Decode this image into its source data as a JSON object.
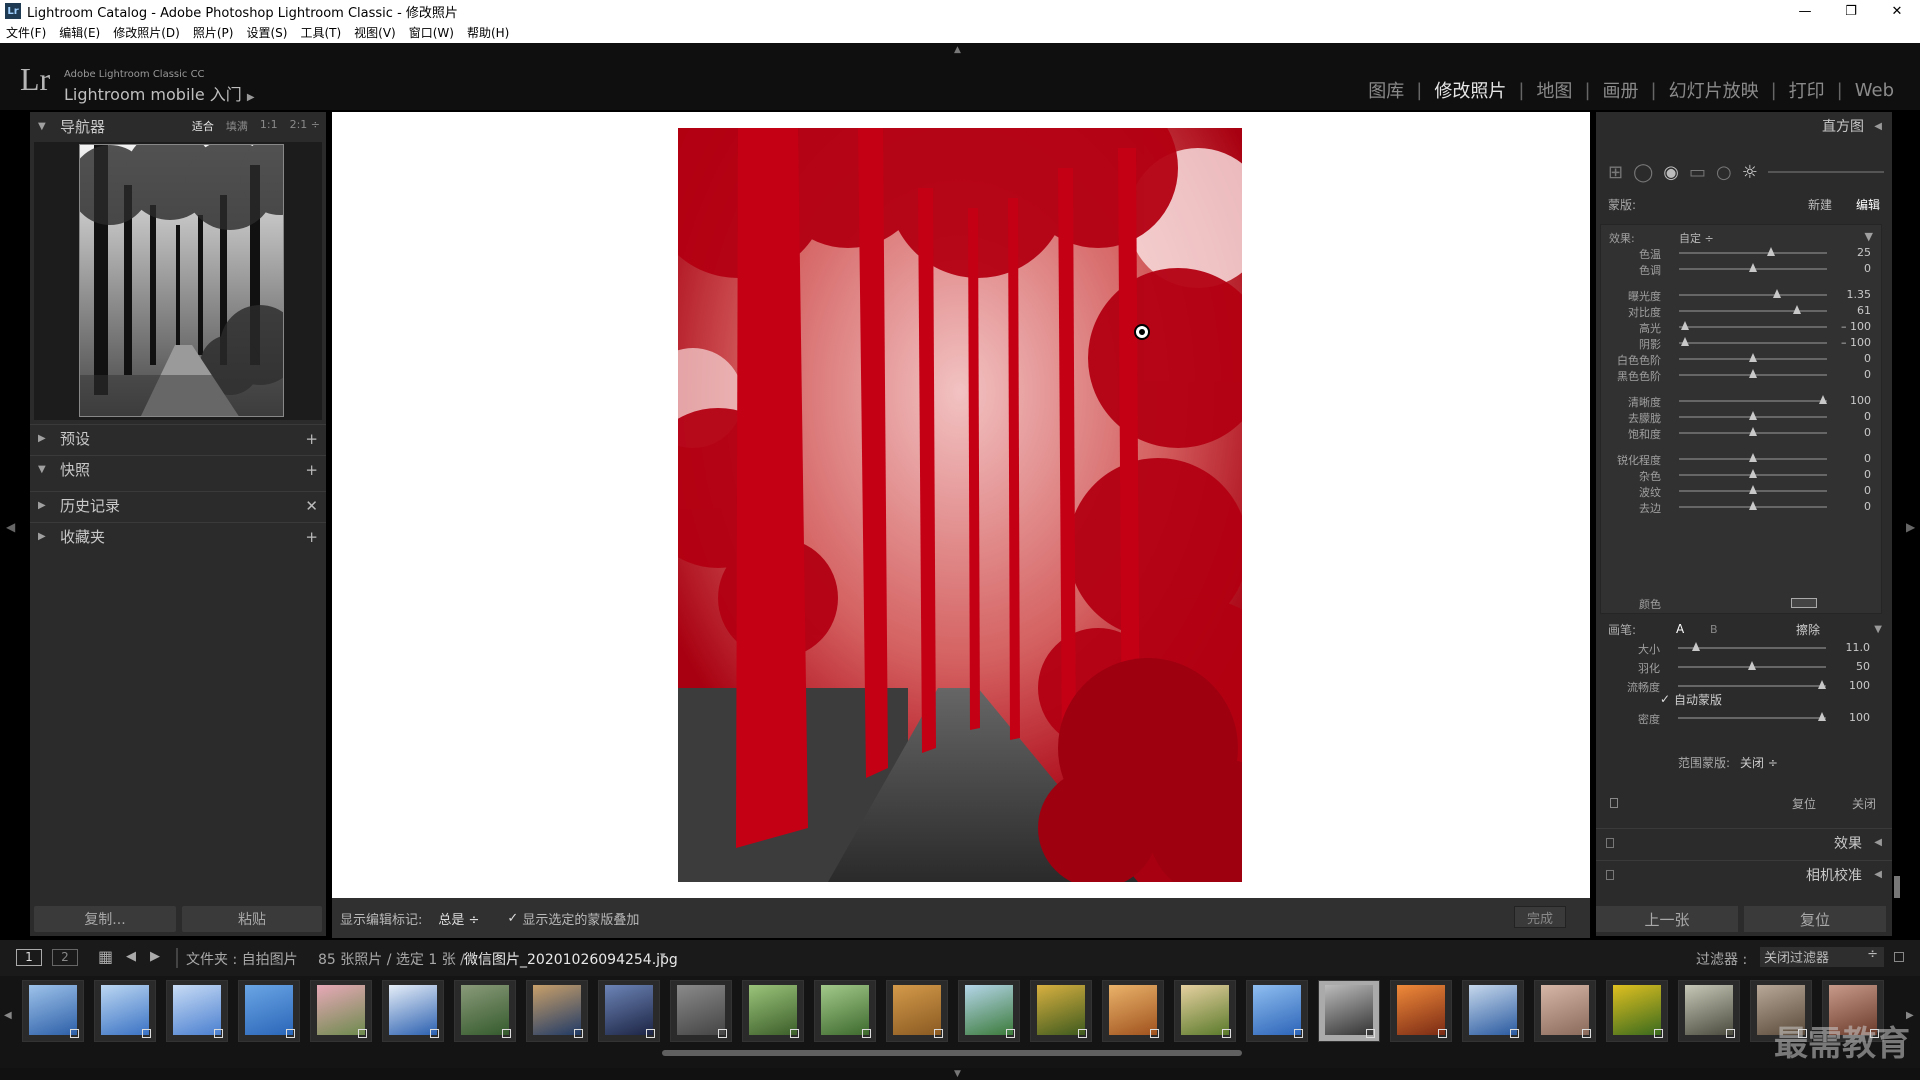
{
  "window": {
    "app_badge": "Lr",
    "title": "Lightroom Catalog - Adobe Photoshop Lightroom Classic - 修改照片",
    "controls": [
      "—",
      "❐",
      "✕"
    ]
  },
  "menu": [
    "文件(F)",
    "编辑(E)",
    "修改照片(D)",
    "照片(P)",
    "设置(S)",
    "工具(T)",
    "视图(V)",
    "窗口(W)",
    "帮助(H)"
  ],
  "identity": {
    "logo": "Lr",
    "small": "Adobe Lightroom Classic CC",
    "big": "Lightroom mobile 入门",
    "arrow": "▶"
  },
  "modules": [
    {
      "label": "图库",
      "active": false
    },
    {
      "label": "修改照片",
      "active": true
    },
    {
      "label": "地图",
      "active": false
    },
    {
      "label": "画册",
      "active": false
    },
    {
      "label": "幻灯片放映",
      "active": false
    },
    {
      "label": "打印",
      "active": false
    },
    {
      "label": "Web",
      "active": false
    }
  ],
  "left_panel": {
    "navigator": {
      "title": "导航器",
      "zoom": [
        "适合",
        "填满",
        "1:1",
        "2:1 ÷"
      ],
      "zoom_active": 0
    },
    "sections": [
      {
        "title": "预设",
        "tri": "▶",
        "action": "+"
      },
      {
        "title": "快照",
        "tri": "▼",
        "action": "+"
      },
      {
        "title": "历史记录",
        "tri": "▶",
        "action": "✕"
      },
      {
        "title": "收藏夹",
        "tri": "▶",
        "action": "+"
      }
    ],
    "copy_button": "复制...",
    "paste_button": "粘贴"
  },
  "toolbar": {
    "show_marks_label": "显示编辑标记:",
    "show_marks_value": "总是 ÷",
    "overlay_check": "✓",
    "overlay_label": "显示选定的蒙版叠加",
    "done_button": "完成"
  },
  "right_panel": {
    "histogram": "直方图",
    "histogram_tri": "◀",
    "mask_label": "蒙版:",
    "mask_new": "新建",
    "mask_edit": "编辑",
    "effect_label": "效果:",
    "effect_value": "自定 ÷",
    "effect_tri": "▼",
    "sliders": [
      {
        "label": "色温",
        "value": "25",
        "pos": 0.62
      },
      {
        "label": "色调",
        "value": "0",
        "pos": 0.5
      },
      {
        "label": "曝光度",
        "value": "1.35",
        "pos": 0.66
      },
      {
        "label": "对比度",
        "value": "61",
        "pos": 0.8
      },
      {
        "label": "高光",
        "value": "– 100",
        "pos": 0.04
      },
      {
        "label": "阴影",
        "value": "– 100",
        "pos": 0.04
      },
      {
        "label": "白色色阶",
        "value": "0",
        "pos": 0.5
      },
      {
        "label": "黑色色阶",
        "value": "0",
        "pos": 0.5
      },
      {
        "label": "清晰度",
        "value": "100",
        "pos": 0.97
      },
      {
        "label": "去朦胧",
        "value": "0",
        "pos": 0.5
      },
      {
        "label": "饱和度",
        "value": "0",
        "pos": 0.5
      },
      {
        "label": "锐化程度",
        "value": "0",
        "pos": 0.5
      },
      {
        "label": "杂色",
        "value": "0",
        "pos": 0.5
      },
      {
        "label": "波纹",
        "value": "0",
        "pos": 0.5
      },
      {
        "label": "去边",
        "value": "0",
        "pos": 0.5
      }
    ],
    "color_label": "颜色",
    "brush_label": "画笔:",
    "brush_a": "A",
    "brush_b": "B",
    "brush_erase": "擦除",
    "brush_sliders": [
      {
        "label": "大小",
        "value": "11.0",
        "pos": 0.12
      },
      {
        "label": "羽化",
        "value": "50",
        "pos": 0.5
      },
      {
        "label": "流畅度",
        "value": "100",
        "pos": 0.97
      }
    ],
    "auto_mask_check": "✓",
    "auto_mask_label": "自动蒙版",
    "density": {
      "label": "密度",
      "value": "100",
      "pos": 0.97
    },
    "range_mask_label": "范围蒙版:",
    "range_mask_value": "关闭 ÷",
    "reset": "复位",
    "close": "关闭",
    "effects_panel": "效果",
    "camera_cal_panel": "相机校准",
    "panel_tri": "◀",
    "prev_button": "上一张",
    "reset_button": "复位"
  },
  "filmstrip_bar": {
    "view_1": "1",
    "view_2": "2",
    "grid_icon": "▦",
    "back": "◀",
    "forward": "▶",
    "source": "文件夹 : 自拍图片",
    "count": "85 张照片 / 选定 1 张 /",
    "filename": "微信图片_20201026094254.jpg",
    "file_dropdown": "▾",
    "filter_label": "过滤器 :",
    "filter_value": "关闭过滤器",
    "filter_dropdown": "÷"
  },
  "watermark": "最需教育",
  "colors": {
    "accent_red": "#b00010",
    "bg": "#2b2b2b",
    "dark": "#141414"
  }
}
